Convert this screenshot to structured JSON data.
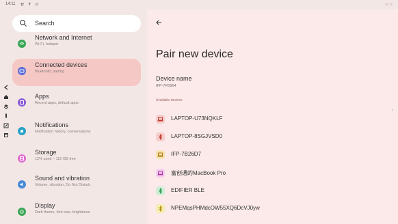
{
  "status_bar": {
    "time": "14:11",
    "icons": "✿ ✝ ⊙",
    "right_icons": "∞ ▽"
  },
  "search": {
    "label": "Search"
  },
  "nav_items": [
    {
      "title": "Network and Internet",
      "subtitle": "Wi-Fi, hotspot",
      "icon": "wifi-icon",
      "color": "#3aa655"
    },
    {
      "title": "Connected devices",
      "subtitle": "Bluetooth, pairing",
      "icon": "devices-icon",
      "color": "#5b6cd9"
    },
    {
      "title": "Apps",
      "subtitle": "Recent apps, default apps",
      "icon": "apps-icon",
      "color": "#8a5ad6"
    },
    {
      "title": "Notifications",
      "subtitle": "Notification history, conversations",
      "icon": "bell-icon",
      "color": "#28a3c7"
    },
    {
      "title": "Storage",
      "subtitle": "12% used – 112 GB free",
      "icon": "storage-icon",
      "color": "#e06cd0"
    },
    {
      "title": "Sound and vibration",
      "subtitle": "Volume, vibration, Do Not Disturb",
      "icon": "sound-icon",
      "color": "#4a8ad8"
    },
    {
      "title": "Display",
      "subtitle": "Dark theme, font size, brightness",
      "icon": "display-icon",
      "color": "#3aa655"
    }
  ],
  "detail": {
    "title": "Pair new device",
    "device_name_label": "Device name",
    "device_name_value": "IFP-7FB964",
    "available_header": "Available devices",
    "devices": [
      {
        "label": "LAPTOP-U73NQKLF",
        "icon": "laptop-icon",
        "bg": "#f6cdcd",
        "fg": "#c0392b"
      },
      {
        "label": "LAPTOP-8SGJVSD0",
        "icon": "bluetooth-icon",
        "bg": "#f6cdcd",
        "fg": "#c0392b"
      },
      {
        "label": "IFP-7B26D7",
        "icon": "laptop-icon",
        "bg": "#f7e2b0",
        "fg": "#b07a10"
      },
      {
        "label": "富创通的MacBook Pro",
        "icon": "laptop-icon",
        "bg": "#f4cdef",
        "fg": "#b03aa0"
      },
      {
        "label": "EDIFIER BLE",
        "icon": "bluetooth-icon",
        "bg": "#cfeed8",
        "fg": "#2f9a52"
      },
      {
        "label": "NPEMqsPHMdcOW55XQ6DcVJ0yw",
        "icon": "bluetooth-icon",
        "bg": "#f7ecb0",
        "fg": "#b09010"
      }
    ]
  }
}
